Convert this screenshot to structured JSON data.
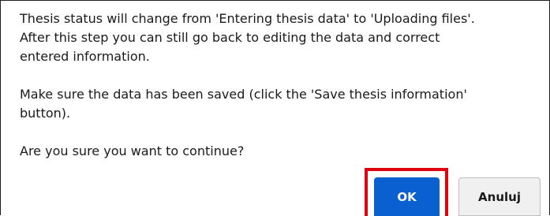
{
  "dialog": {
    "message": {
      "paragraph1": {
        "line1": "Thesis status will change from 'Entering thesis data' to 'Uploading files'.",
        "line2": "After this step you can still go back to editing the data and correct",
        "line3": "entered information."
      },
      "paragraph2": {
        "line1": "Make sure the data has been saved (click the 'Save thesis information'",
        "line2": "button)."
      },
      "paragraph3": {
        "line1": "Are you sure you want to continue?"
      }
    },
    "buttons": {
      "ok_label": "OK",
      "cancel_label": "Anuluj"
    },
    "colors": {
      "ok_background": "#0a5fd1",
      "highlight_border": "#e0000f",
      "cancel_background": "#f0f0f0"
    }
  }
}
